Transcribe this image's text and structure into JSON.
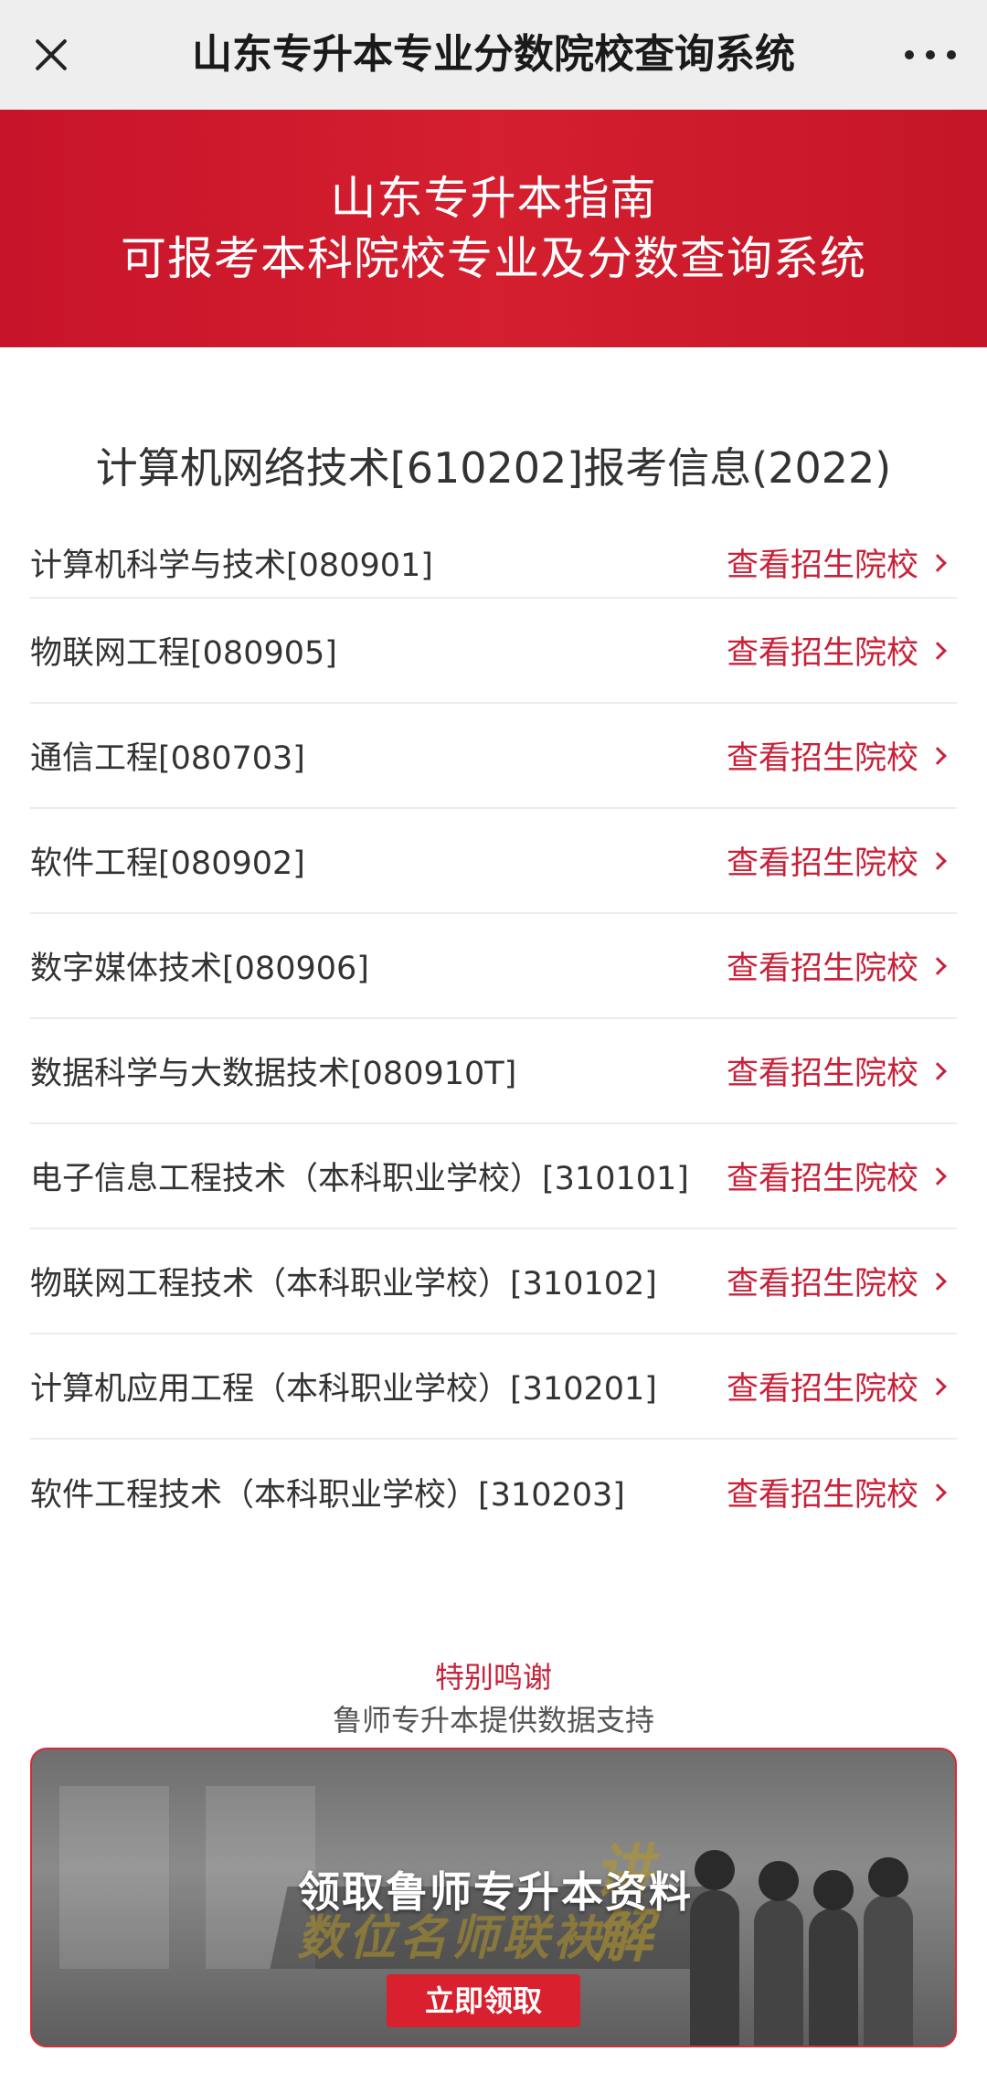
{
  "topbar": {
    "title": "山东专升本专业分数院校查询系统"
  },
  "banner": {
    "line1": "山东专升本指南",
    "line2": "可报考本科院校专业及分数查询系统"
  },
  "section": {
    "title": "计算机网络技术[610202]报考信息(2022)"
  },
  "majors": [
    {
      "name": "计算机科学与技术[080901]",
      "link": "查看招生院校"
    },
    {
      "name": "物联网工程[080905]",
      "link": "查看招生院校"
    },
    {
      "name": "通信工程[080703]",
      "link": "查看招生院校"
    },
    {
      "name": "软件工程[080902]",
      "link": "查看招生院校"
    },
    {
      "name": "数字媒体技术[080906]",
      "link": "查看招生院校"
    },
    {
      "name": "数据科学与大数据技术[080910T]",
      "link": "查看招生院校"
    },
    {
      "name": "电子信息工程技术（本科职业学校）[310101]",
      "link": "查看招生院校"
    },
    {
      "name": "物联网工程技术（本科职业学校）[310102]",
      "link": "查看招生院校"
    },
    {
      "name": "计算机应用工程（本科职业学校）[310201]",
      "link": "查看招生院校"
    },
    {
      "name": "软件工程技术（本科职业学校）[310203]",
      "link": "查看招生院校"
    }
  ],
  "thanks": {
    "title": "特别鸣谢",
    "subtitle": "鲁师专升本提供数据支持"
  },
  "ad": {
    "title": "领取鲁师专升本资料",
    "deco_text": "数位名师联袂",
    "deco_char": "讲解",
    "button": "立即领取"
  },
  "colors": {
    "accent": "#c8223a",
    "banner": "#d41f2f",
    "topbar": "#eeeeee"
  }
}
